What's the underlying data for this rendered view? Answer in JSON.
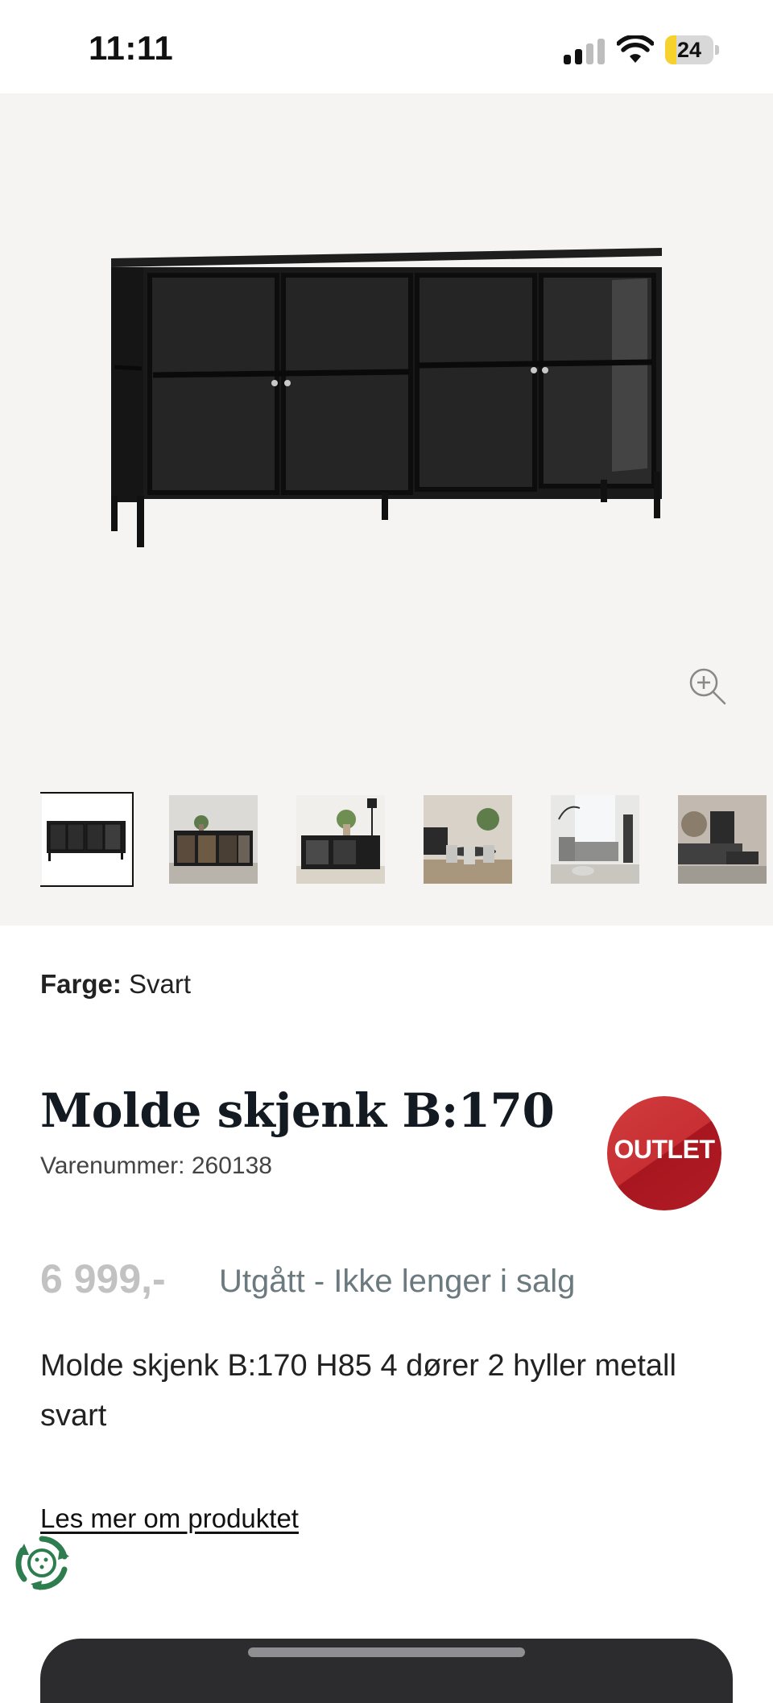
{
  "status_bar": {
    "time": "11:11",
    "battery": "24",
    "battery_level": 0.24,
    "signal_icon": "cellular-signal-icon",
    "wifi_icon": "wifi-icon"
  },
  "gallery": {
    "main_image": "black metal sideboard with four glass doors",
    "zoom_icon": "zoom-in-icon",
    "thumbnails": [
      {
        "name": "sideboard-front",
        "active": true
      },
      {
        "name": "sideboard-room-1",
        "active": false
      },
      {
        "name": "sideboard-room-2",
        "active": false
      },
      {
        "name": "dining-room",
        "active": false
      },
      {
        "name": "living-room",
        "active": false
      },
      {
        "name": "lounge-room",
        "active": false
      }
    ]
  },
  "product": {
    "color_label": "Farge:",
    "color_value": "Svart",
    "title": "Molde skjenk B:170",
    "sku_label": "Varenummer:",
    "sku_value": "260138",
    "badge": "OUTLET",
    "price": "6 999,-",
    "availability": "Utgått - Ikke lenger i salg",
    "description": "Molde skjenk B:170 H85 4 dører 2 hyller metall svart",
    "read_more": "Les mer om produktet"
  },
  "colors": {
    "badge_red": "#c72f34",
    "availability_gray": "#6b7a7f",
    "price_gray": "#c2c2c2",
    "gallery_bg": "#f5f4f2",
    "eco_green": "#2e7d4f"
  },
  "icons": {
    "eco": "recycle-eco-icon"
  }
}
